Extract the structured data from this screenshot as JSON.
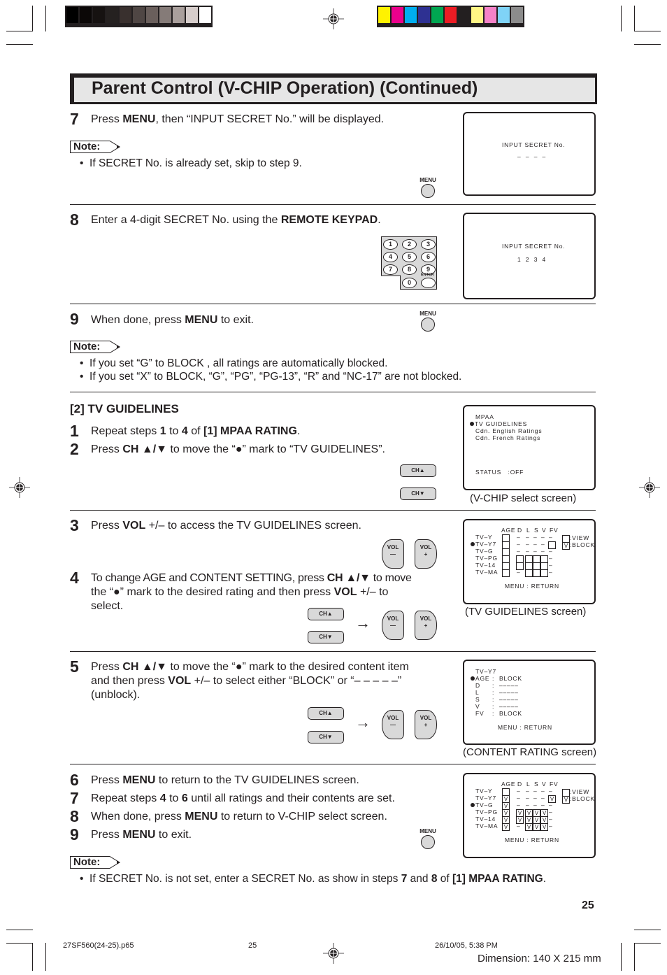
{
  "color_bar": {
    "gray": [
      "#000000",
      "#0b0807",
      "#161211",
      "#252120",
      "#39302e",
      "#4f4644",
      "#6a5f5c",
      "#857b78",
      "#a99f9c",
      "#d6cdcb",
      "#ffffff"
    ],
    "color": [
      "#fff200",
      "#ec008c",
      "#00aeef",
      "#2e3192",
      "#00a651",
      "#ed1c24",
      "#231f20",
      "#fff685",
      "#f582c8",
      "#7fd3f7",
      "#8c8c8c"
    ]
  },
  "title": "Parent Control (V-CHIP Operation) (Continued)",
  "note_label": "Note:",
  "steps_top": {
    "s7": {
      "num": "7",
      "pre": "Press ",
      "bold": "MENU",
      "post": ", then “INPUT SECRET No.” will be displayed."
    },
    "s7_note": "If SECRET No. is already set, skip to step 9.",
    "s8": {
      "num": "8",
      "pre": "Enter a 4-digit SECRET No. using the ",
      "bold": "REMOTE KEYPAD",
      "post": "."
    },
    "s9": {
      "num": "9",
      "pre": "When done, press ",
      "bold": "MENU",
      "post": " to exit."
    },
    "s9_notes": [
      "If you set “G” to BLOCK , all ratings are automatically blocked.",
      "If you set “X” to BLOCK, “G”, “PG”, “PG-13”, “R” and “NC-17” are not blocked."
    ]
  },
  "buttons": {
    "menu": "MENU",
    "ch_up": "CH▲",
    "ch_down": "CH▼",
    "vol_minus": [
      "VOL",
      "—"
    ],
    "vol_plus": [
      "VOL",
      "+"
    ],
    "arrow": "→",
    "enter": "ENTER",
    "keys": [
      "1",
      "2",
      "3",
      "4",
      "5",
      "6",
      "7",
      "8",
      "9",
      "0"
    ]
  },
  "screens": {
    "secret_empty": {
      "title": "INPUT SECRET No.",
      "value": "–  –  –  –"
    },
    "secret_filled": {
      "title": "INPUT SECRET No.",
      "value": "1  2  3  4"
    },
    "vchip": {
      "items": [
        "MPAA",
        "TV GUIDELINES",
        "Cdn. English Ratings",
        "Cdn. French Ratings"
      ],
      "selected": "TV GUIDELINES",
      "status": "STATUS   :OFF",
      "caption": "(V-CHIP select screen)"
    },
    "tv_guidelines": {
      "headers": [
        "AGE",
        "D",
        "L",
        "S",
        "V",
        "FV"
      ],
      "rows": [
        "TV–Y",
        "TV–Y7",
        "TV–G",
        "TV–PG",
        "TV–14",
        "TV–MA"
      ],
      "legend": [
        ":VIEW",
        ":BLOCK"
      ],
      "legend_mark": "V",
      "footer": "MENU : RETURN",
      "caption": "(TV GUIDELINES screen)"
    },
    "content_rating": {
      "rating": "TV–Y7",
      "items": [
        {
          "k": "AGE",
          "v": "BLOCK"
        },
        {
          "k": "D",
          "v": "–––––"
        },
        {
          "k": "L",
          "v": "–––––"
        },
        {
          "k": "S",
          "v": "–––––"
        },
        {
          "k": "V",
          "v": "–––––"
        },
        {
          "k": "FV",
          "v": "BLOCK"
        }
      ],
      "footer": "MENU : RETURN",
      "caption": "(CONTENT RATING screen)"
    }
  },
  "section": {
    "heading": "[2] TV GUIDELINES",
    "s1": {
      "num": "1",
      "html": "Repeat steps <b>1</b> to <b>4</b> of <b>[1] MPAA RATING</b>."
    },
    "s2": {
      "num": "2",
      "html": "Press <b>CH ▲/▼</b> to move the “●” mark to “TV GUIDELINES”."
    },
    "s3": {
      "num": "3",
      "html": "Press <b>VOL</b> +/– to access the TV GUIDELINES screen."
    },
    "s4": {
      "num": "4",
      "lines": [
        "To change AGE and CONTENT SETTING, press <b>CH ▲/▼</b> to move",
        "the “●” mark to the desired rating and then press <b>VOL</b> +/– to",
        "select."
      ]
    },
    "s5": {
      "num": "5",
      "lines": [
        "Press <b>CH ▲/▼</b> to move the “●” mark to the desired content item",
        "and then press <b>VOL</b> +/– to select either “BLOCK” or “– – – – –”",
        "(unblock)."
      ]
    },
    "s6": {
      "num": "6",
      "html": "Press <b>MENU</b> to return to the TV GUIDELINES screen."
    },
    "s7": {
      "num": "7",
      "html": "Repeat steps <b>4</b> to <b>6</b> until all ratings and their contents are set."
    },
    "s8": {
      "num": "8",
      "html": "When done, press <b>MENU</b> to return to V-CHIP select screen."
    },
    "s9": {
      "num": "9",
      "html": "Press <b>MENU</b> to exit."
    },
    "final_note": "If SECRET No. is not set, enter a SECRET No. as show in steps <b>7</b> and <b>8</b> of <b>[1] MPAA RATING</b>."
  },
  "page_number": "25",
  "footer": {
    "file": "27SF560(24-25).p65",
    "page": "25",
    "date": "26/10/05, 5:38 PM",
    "dimension": "Dimension: 140  X 215 mm"
  }
}
